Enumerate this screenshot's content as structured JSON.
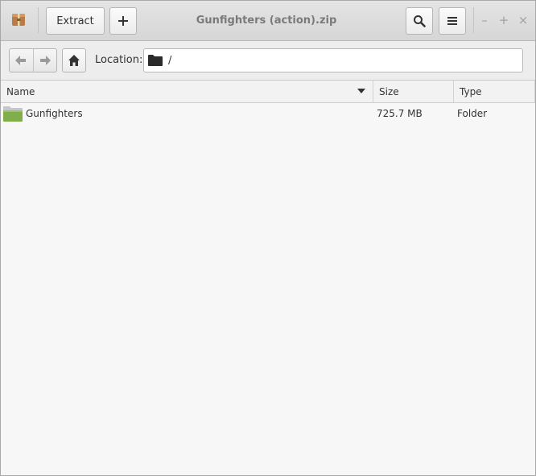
{
  "header": {
    "title": "Gunfighters (action).zip",
    "extract_label": "Extract",
    "add_label": "+",
    "minimize_glyph": "–",
    "maximize_glyph": "+",
    "close_glyph": "×"
  },
  "toolbar": {
    "location_label": "Location:",
    "location_path": "/"
  },
  "columns": {
    "name": "Name",
    "size": "Size",
    "type": "Type"
  },
  "files": [
    {
      "name": "Gunfighters",
      "size": "725.7 MB",
      "type": "Folder",
      "icon": "folder-green-icon"
    }
  ],
  "colors": {
    "folder_green": "#7fae4a",
    "header_title": "#7a7a7a"
  }
}
